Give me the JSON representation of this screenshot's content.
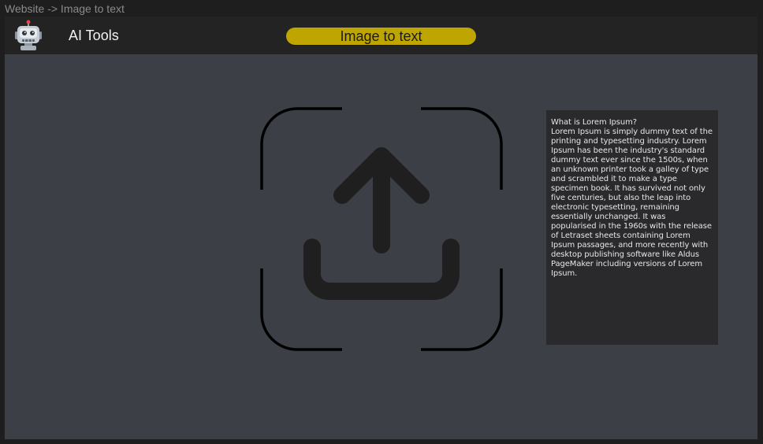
{
  "frame": {
    "label": "Website -> Image to text"
  },
  "header": {
    "logo_icon": "robot-icon",
    "brand": "AI Tools",
    "active_tab": "Image to text"
  },
  "upload": {
    "icon": "upload-icon",
    "frame_icon": "scan-corners-icon"
  },
  "info": {
    "title": "What is Lorem Ipsum?",
    "body": "Lorem Ipsum is simply dummy text of the printing and typesetting industry. Lorem Ipsum has been the industry's standard dummy text ever since the 1500s, when an unknown printer took a galley of type and scrambled it to make a type specimen book. It has survived not only five centuries, but also the leap into electronic typesetting, remaining essentially unchanged. It was popularised in the 1960s with the release of Letraset sheets containing Lorem Ipsum passages, and more recently with desktop publishing software like Aldus PageMaker including versions of Lorem Ipsum."
  },
  "colors": {
    "accent": "#bfa500",
    "page_bg": "#3d3f46",
    "header_bg": "#232323",
    "panel_bg": "#2a2a2c"
  }
}
